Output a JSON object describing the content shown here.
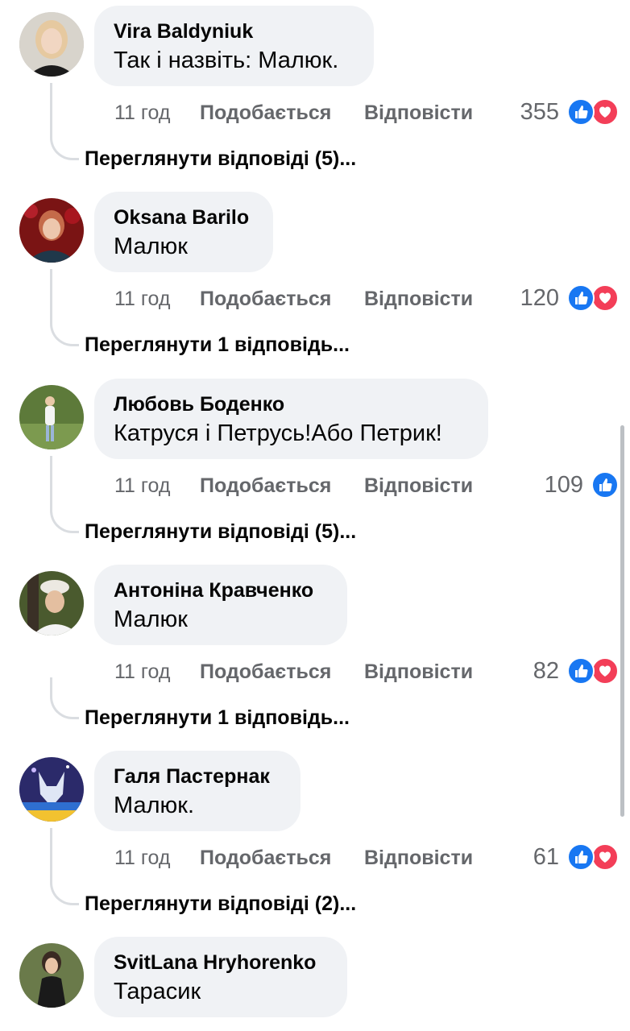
{
  "comments": [
    {
      "author": "Vira Baldyniuk",
      "text": "Так і назвіть: Малюк.",
      "time": "11 год",
      "like_label": "Подобається",
      "reply_label": "Відповісти",
      "reaction_count": "355",
      "reactions": [
        "like",
        "love"
      ],
      "view_replies": "Переглянути відповіді (5)..."
    },
    {
      "author": "Oksana Barilo",
      "text": "Малюк",
      "time": "11 год",
      "like_label": "Подобається",
      "reply_label": "Відповісти",
      "reaction_count": "120",
      "reactions": [
        "like",
        "love"
      ],
      "view_replies": "Переглянути 1 відповідь..."
    },
    {
      "author": "Любовь Боденко",
      "text": "Катруся і Петрусь!Або Петрик!",
      "time": "11 год",
      "like_label": "Подобається",
      "reply_label": "Відповісти",
      "reaction_count": "109",
      "reactions": [
        "like"
      ],
      "view_replies": "Переглянути відповіді (5)..."
    },
    {
      "author": "Антоніна Кравченко",
      "text": "Малюк",
      "time": "11 год",
      "like_label": "Подобається",
      "reply_label": "Відповісти",
      "reaction_count": "82",
      "reactions": [
        "like",
        "love"
      ],
      "view_replies": "Переглянути 1 відповідь..."
    },
    {
      "author": "Галя Пастернак",
      "text": "Малюк.",
      "time": "11 год",
      "like_label": "Подобається",
      "reply_label": "Відповісти",
      "reaction_count": "61",
      "reactions": [
        "like",
        "love"
      ],
      "view_replies": "Переглянути відповіді (2)..."
    },
    {
      "author": "SvitLana Hryhorenko",
      "text": "Тарасик"
    }
  ],
  "colors": {
    "bubble": "#f0f2f5",
    "meta_text": "#65676b",
    "like_blue": "#1877f2",
    "love_red": "#f33e58"
  }
}
